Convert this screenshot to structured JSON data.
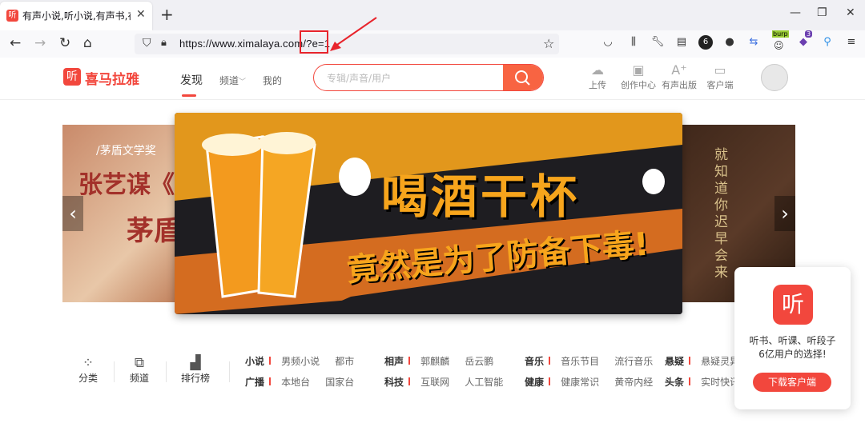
{
  "browser": {
    "tab_title": "有声小说,听小说,有声书,在线听",
    "tab_favicon": "听",
    "url": "https://www.ximalaya.com/?e=1",
    "ext_badge_count": "6",
    "ext_badge_count2": "3",
    "ext_burp_label": "burp"
  },
  "site": {
    "logo_icon": "听",
    "logo_text": "喜马拉雅",
    "nav": [
      "发现",
      "频道",
      "我的"
    ],
    "search_placeholder": "专辑/声音/用户",
    "tools": [
      "上传",
      "创作中心",
      "有声出版",
      "客户端"
    ]
  },
  "carousel": {
    "main_title": "喝酒干杯",
    "main_subtitle": "竟然是为了防备下毒!",
    "left_slide_lines": [
      "/茅盾文学奖",
      "张艺谋《大",
      "茅盾"
    ],
    "right_slide_text": "就知道你迟早会来"
  },
  "categories": [
    "分类",
    "频道",
    "排行榜"
  ],
  "keyword_rows": [
    [
      {
        "kw": "小说",
        "links": [
          "男频小说",
          "都市"
        ]
      },
      {
        "kw": "相声",
        "links": [
          "郭麒麟",
          "岳云鹏"
        ]
      },
      {
        "kw": "音乐",
        "links": [
          "音乐节目",
          "流行音乐"
        ]
      },
      {
        "kw": "悬疑",
        "links": [
          "悬疑灵异"
        ]
      }
    ],
    [
      {
        "kw": "广播",
        "links": [
          "本地台",
          "国家台"
        ]
      },
      {
        "kw": "科技",
        "links": [
          "互联网",
          "人工智能"
        ]
      },
      {
        "kw": "健康",
        "links": [
          "健康常识",
          "黄帝内经"
        ]
      },
      {
        "kw": "头条",
        "links": [
          "实时快讯"
        ]
      }
    ]
  ],
  "popup": {
    "logo": "听",
    "line1": "听书、听课、听段子",
    "line2": "6亿用户的选择!",
    "button": "下载客户端"
  },
  "colors": {
    "brand": "#f2473d",
    "annotation": "#e8242c",
    "banner_orange": "#f7a51c"
  }
}
